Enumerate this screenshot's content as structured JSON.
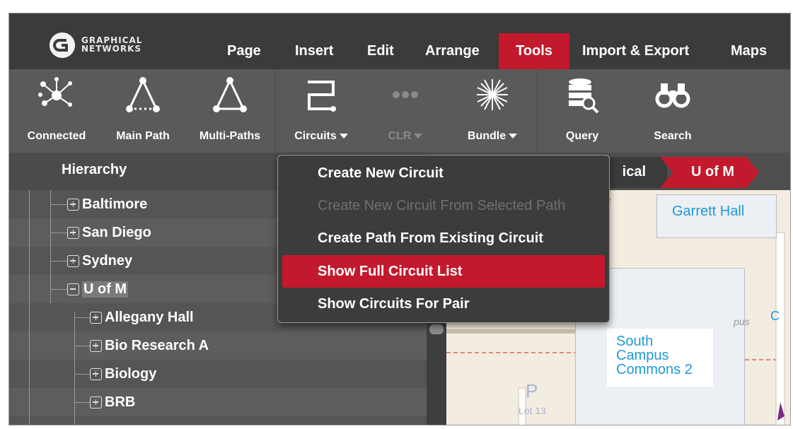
{
  "app": {
    "logo_line1": "GRAPHICAL",
    "logo_line2": "NETWORKS"
  },
  "menu": {
    "items": [
      {
        "label": "Page"
      },
      {
        "label": "Insert"
      },
      {
        "label": "Edit"
      },
      {
        "label": "Arrange"
      },
      {
        "label": "Tools",
        "active": true
      },
      {
        "label": "Import & Export"
      },
      {
        "label": "Maps"
      }
    ],
    "accent_color": "#c3192d"
  },
  "toolbar": {
    "connected": "Connected",
    "main_path": "Main Path",
    "multi_paths": "Multi-Paths",
    "circuits": "Circuits",
    "clr": "CLR",
    "bundle": "Bundle",
    "query": "Query",
    "search": "Search"
  },
  "hierarchy": {
    "title": "Hierarchy",
    "nodes": [
      {
        "label": "Baltimore",
        "state": "collapsed"
      },
      {
        "label": "San Diego",
        "state": "collapsed"
      },
      {
        "label": "Sydney",
        "state": "collapsed"
      },
      {
        "label": "U of M",
        "state": "expanded",
        "selected": true
      },
      {
        "label": "Allegany Hall",
        "state": "collapsed"
      },
      {
        "label": "Bio Research A",
        "state": "collapsed"
      },
      {
        "label": "Biology",
        "state": "collapsed"
      },
      {
        "label": "BRB",
        "state": "collapsed"
      }
    ]
  },
  "breadcrumb": {
    "physical": "ical",
    "current": "U of M"
  },
  "dropdown": {
    "items": [
      {
        "label": "Create New Circuit",
        "enabled": true
      },
      {
        "label": "Create New Circuit From Selected Path",
        "enabled": false
      },
      {
        "label": "Create Path From Existing Circuit",
        "enabled": true
      },
      {
        "label": "Show Full Circuit List",
        "enabled": true,
        "highlighted": true
      },
      {
        "label": "Show Circuits For Pair",
        "enabled": true
      }
    ]
  },
  "map": {
    "garrett": "Garrett Hall",
    "south_1": "South",
    "south_2": "Campus",
    "south_3": "Commons 2",
    "c_partial": "C",
    "lot": "Lot 13",
    "p_label": "P",
    "pus": "pus"
  }
}
